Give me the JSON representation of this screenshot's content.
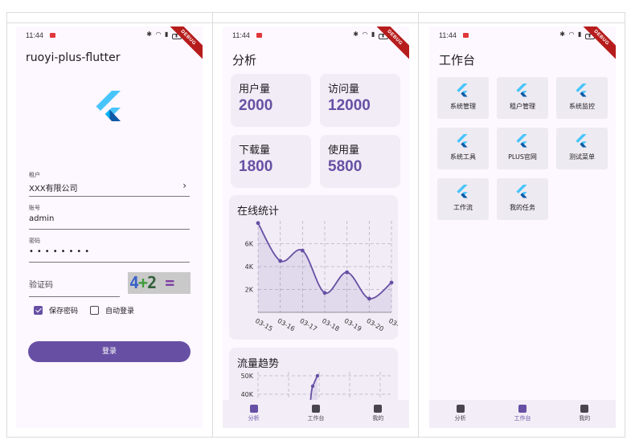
{
  "status": {
    "time": "11:44",
    "banner": "DEBUG"
  },
  "login": {
    "title": "ruoyi-plus-flutter",
    "tenant": {
      "label": "租户",
      "value": "XXX有限公司"
    },
    "account": {
      "label": "账号",
      "value": "admin"
    },
    "password": {
      "label": "密码",
      "value": "••••••••"
    },
    "captcha": {
      "placeholder": "验证码",
      "image_text": "4+2 ="
    },
    "remember": {
      "label": "保存密码",
      "checked": true
    },
    "auto_login": {
      "label": "自动登录",
      "checked": false
    },
    "submit_label": "登录"
  },
  "analysis": {
    "title": "分析",
    "stats": [
      {
        "label": "用户量",
        "value": "2000"
      },
      {
        "label": "访问量",
        "value": "12000"
      },
      {
        "label": "下载量",
        "value": "1800"
      },
      {
        "label": "使用量",
        "value": "5800"
      }
    ],
    "online_title": "在线统计",
    "traffic_title": "流量趋势"
  },
  "chart_data": [
    {
      "type": "line",
      "title": "在线统计",
      "x": [
        "03-15",
        "03-16",
        "03-17",
        "03-18",
        "03-19",
        "03-20",
        "03-21"
      ],
      "values": [
        7800,
        4500,
        5400,
        1700,
        3500,
        1200,
        2600
      ],
      "yticks": [
        "2K",
        "4K",
        "6K"
      ],
      "ylim": [
        0,
        8000
      ],
      "color": "#6750a4",
      "grid": true
    },
    {
      "type": "line",
      "title": "流量趋势",
      "yticks": [
        "40K",
        "50K"
      ],
      "values": [
        35000,
        45000,
        50000
      ],
      "color": "#6750a4",
      "grid": true
    }
  ],
  "workbench": {
    "title": "工作台",
    "tiles": [
      "系统管理",
      "租户管理",
      "系统监控",
      "系统工具",
      "PLUS官网",
      "测试菜单",
      "工作流",
      "我的任务"
    ]
  },
  "nav": {
    "items": [
      "分析",
      "工作台",
      "我的"
    ]
  },
  "colors": {
    "primary": "#6750a4",
    "card": "#f2ecf6",
    "flutter_light": "#47c5fb",
    "flutter_dark": "#0c5aa5"
  }
}
